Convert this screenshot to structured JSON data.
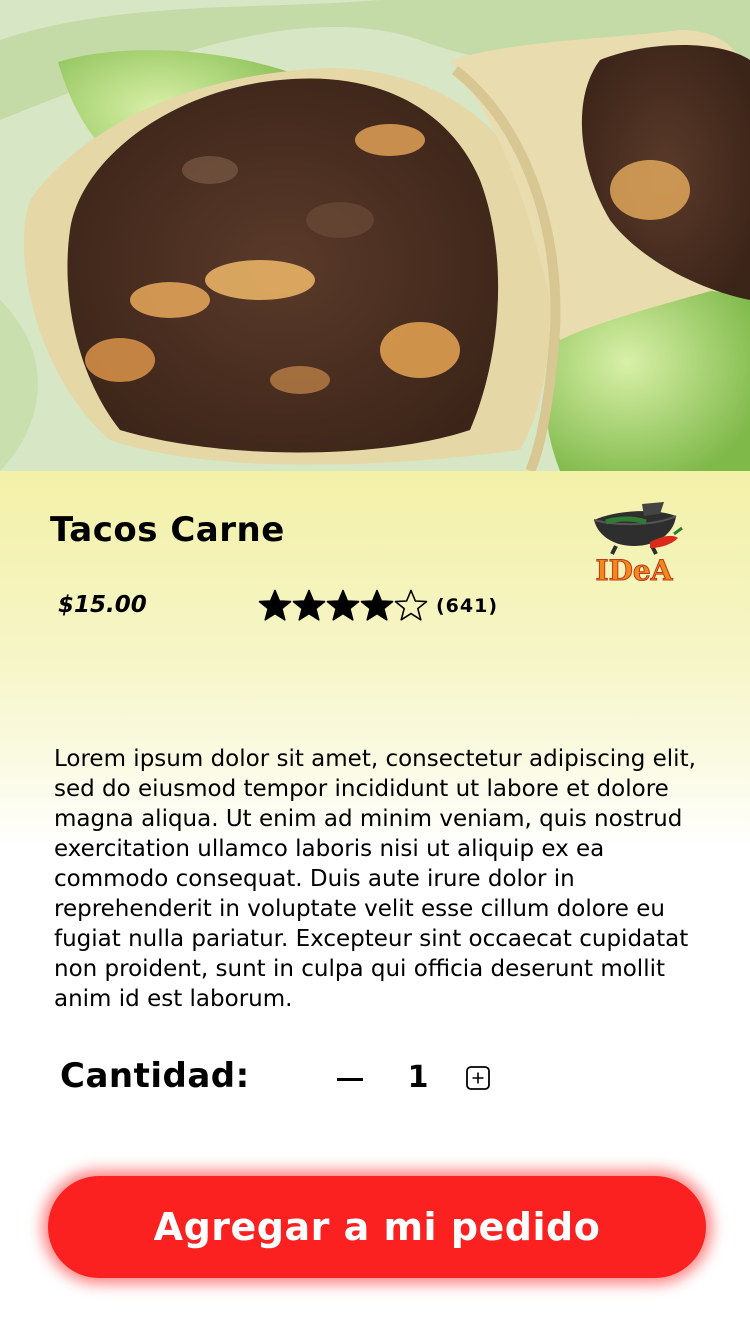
{
  "product": {
    "name": "Tacos Carne",
    "price": "$15.00",
    "rating": {
      "value": 4,
      "max": 5,
      "count_label": "(641)"
    },
    "description": "Lorem ipsum dolor sit amet, consectetur adipiscing elit, sed do eiusmod tempor incididunt ut labore et dolore magna aliqua. Ut enim ad minim veniam, quis nostrud exercitation ullamco laboris nisi ut aliquip ex ea commodo consequat. Duis aute irure dolor in reprehenderit in voluptate velit esse cillum dolore eu fugiat nulla pariatur. Excepteur sint occaecat cupidatat non proident, sunt in culpa qui officia deserunt mollit anim id est laborum."
  },
  "brand": {
    "logo_text": "IDeA"
  },
  "quantity": {
    "label": "Cantidad:",
    "value": "1"
  },
  "cta": {
    "label": "Agregar a mi pedido"
  },
  "colors": {
    "cta": "#fb2121",
    "panel_top": "#f3f1a8",
    "star": "#000000"
  }
}
